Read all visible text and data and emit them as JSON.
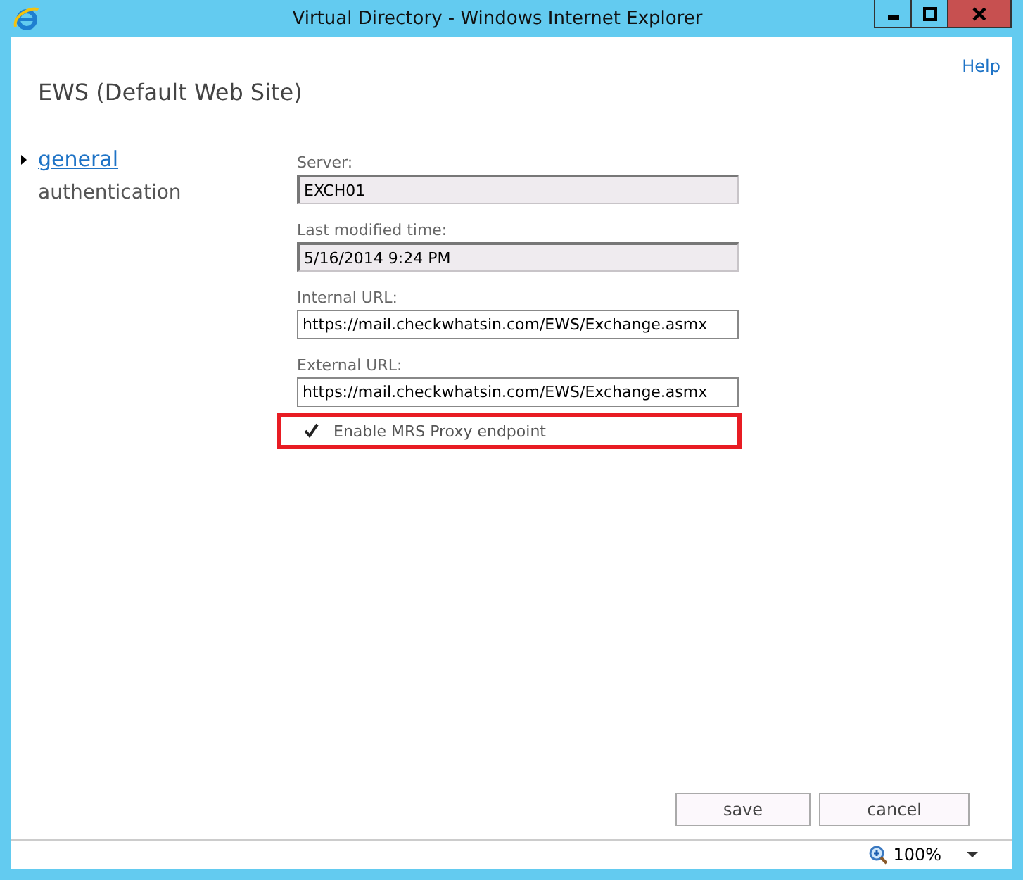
{
  "window": {
    "title": "Virtual Directory - Windows Internet Explorer"
  },
  "help_link": "Help",
  "page_title": "EWS (Default Web Site)",
  "nav": [
    {
      "label": "general",
      "selected": true
    },
    {
      "label": "authentication",
      "selected": false
    }
  ],
  "fields": [
    {
      "label": "Server:",
      "value": "EXCH01",
      "readonly": true
    },
    {
      "label": "Last modified time:",
      "value": "5/16/2014 9:24 PM",
      "readonly": true
    },
    {
      "label": "Internal URL:",
      "value": "https://mail.checkwhatsin.com/EWS/Exchange.asmx",
      "readonly": false
    },
    {
      "label": "External URL:",
      "value": "https://mail.checkwhatsin.com/EWS/Exchange.asmx",
      "readonly": false
    }
  ],
  "mrs_proxy": {
    "label": "Enable MRS Proxy endpoint",
    "checked": true,
    "highlighted": true
  },
  "buttons": [
    "save",
    "cancel"
  ],
  "status_bar": {
    "zoom": "100%"
  }
}
